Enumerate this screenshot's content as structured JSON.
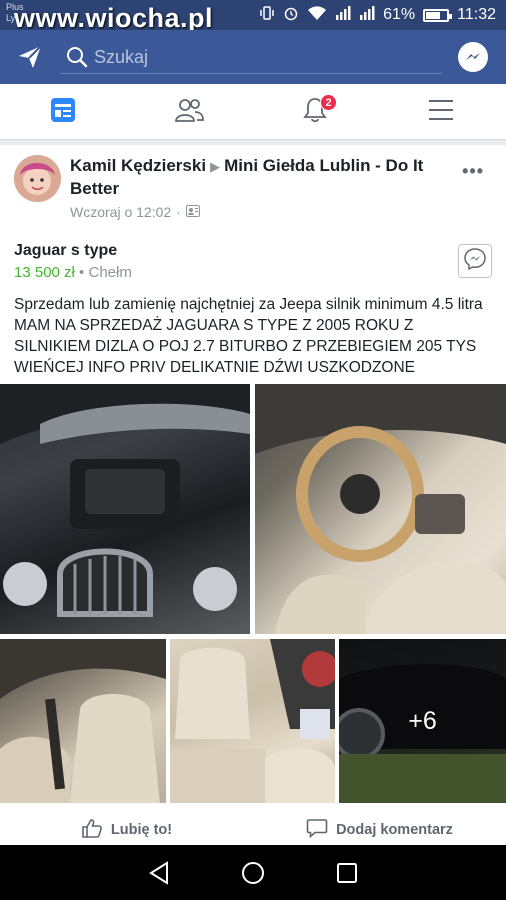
{
  "status_bar": {
    "carrier_line1": "Plus",
    "carrier_line2": "Ly",
    "watermark": "www.wiocha.pl",
    "battery": "61%",
    "time": "11:32"
  },
  "header": {
    "search_placeholder": "Szukaj"
  },
  "tabs": [
    {
      "name": "news-feed",
      "icon": "news-feed-icon"
    },
    {
      "name": "friends",
      "icon": "friends-icon"
    },
    {
      "name": "notifications",
      "icon": "bell-icon",
      "badge": "2"
    },
    {
      "name": "menu",
      "icon": "hamburger-icon"
    }
  ],
  "post": {
    "author": "Kamil Kędzierski",
    "group": "Mini Giełda Lublin - Do It Better",
    "time": "Wczoraj o 12:02",
    "item_title": "Jaguar s type",
    "price": "13 500 zł",
    "location_sep": " • ",
    "location": "Chełm",
    "text": "Sprzedam lub zamienię najchętniej za Jeepa silnik minimum 4.5 litra   MAM NA SPRZEDAŻ JAGUARA S TYPE Z 2005 ROKU Z SILNIKIEM DIZLA O POJ 2.7 BITURBO Z PRZEBIEGIEM 205 TYS WIEŃCEJ INFO PRIV DELIKATNIE DŹWI USZKODZONE",
    "more_photos": "+6",
    "like_label": "Lubię to!",
    "comment_label": "Dodaj komentarz"
  },
  "colors": {
    "facebook_blue": "#3b5998",
    "status_bar": "#2d4373",
    "price_green": "#42b72a",
    "badge_red": "#f02849"
  }
}
